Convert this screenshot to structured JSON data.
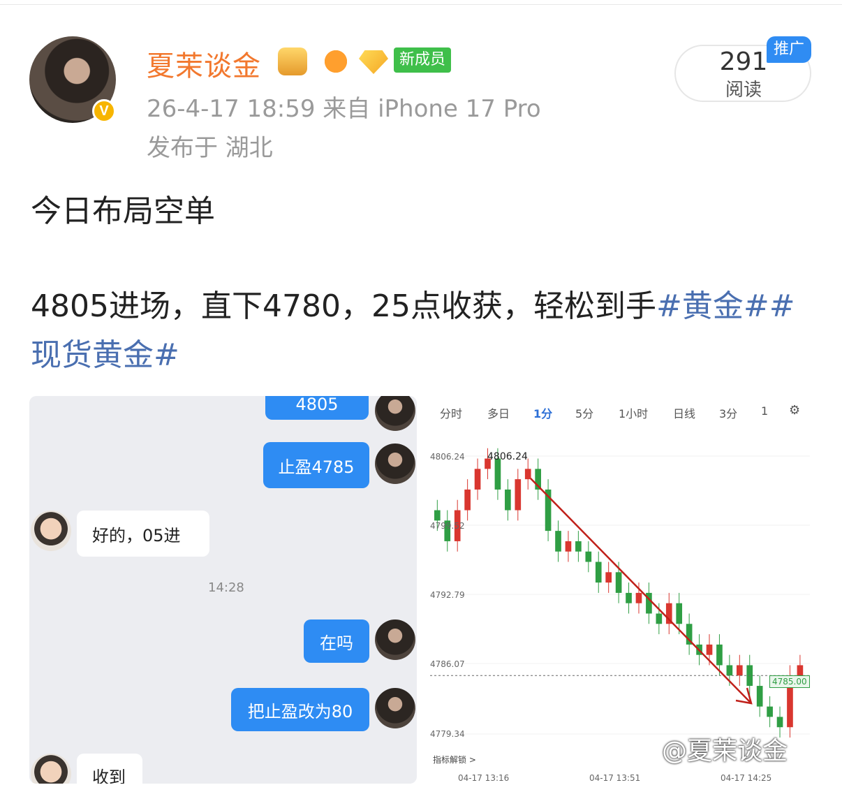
{
  "post": {
    "username": "夏茉谈金",
    "new_member_badge": "新成员",
    "verified_mark": "V",
    "timestamp_source": "26-4-17 18:59  来自 iPhone 17 Pro",
    "location": "发布于 湖北",
    "read_count": "291",
    "read_label": "阅读",
    "promo_label": "推广",
    "line1": "今日布局空单",
    "line2_text": "4805进场，直下4780，25点收获，轻松到手",
    "tag1": "#黄金#",
    "tag2": "#现货黄金#",
    "watermark": "@夏茉谈金"
  },
  "chat": {
    "msg_top": "4805",
    "msg1": "止盈4785",
    "msg2": "好的，05进",
    "time": "14:28",
    "msg3": "在吗",
    "msg4": "把止盈改为80",
    "msg5": "收到"
  },
  "chart_tabs": [
    "分时",
    "多日",
    "1分",
    "5分",
    "1小时",
    "日线",
    "3分",
    "1"
  ],
  "chart_lock": "指标解锁 >",
  "chart_data": {
    "type": "line",
    "title": "",
    "y_ticks": [
      "4806.24",
      "4799.52",
      "4792.79",
      "4786.07",
      "4779.34"
    ],
    "x_ticks": [
      "04-17 13:16",
      "04-17 13:51",
      "04-17 14:25"
    ],
    "high_label": "4806.24",
    "current_price_label": "4785.00",
    "ylim": [
      4779.34,
      4806.24
    ],
    "series": [
      {
        "values": [
          4800,
          4798,
          4801,
          4803,
          4805,
          4806,
          4803,
          4801,
          4804,
          4805,
          4803,
          4799,
          4797,
          4798,
          4797,
          4796,
          4794,
          4795,
          4793,
          4792,
          4793,
          4791,
          4790,
          4792,
          4790,
          4788,
          4787,
          4788,
          4786,
          4785,
          4786,
          4784,
          4782,
          4781,
          4780,
          4785,
          4786
        ]
      }
    ]
  },
  "colors": {
    "accent_orange": "#f2782e",
    "tag_blue": "#4a6fb0",
    "bubble_blue": "#2e8cf3",
    "up": "#d9362f",
    "down": "#2f9e44"
  }
}
